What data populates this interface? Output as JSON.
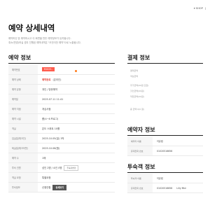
{
  "topnav": {
    "shop": "▾ SHOP",
    "sep": "|"
  },
  "page_title": "예약 상세내역",
  "description": [
    "예약하신 방 예약하시고 이 화면을 만든 예약정보가 유지됩니다.",
    "취소(변경)하실 경우 진행된 예약내역은 \"오전이전 예약\"으로 노출됩니다."
  ],
  "reservation": {
    "title": "예약 정보",
    "rows": [
      {
        "label": "예약번호",
        "value": "R2025..",
        "type": "badge"
      },
      {
        "label": "예약 상태",
        "value": "예약완료",
        "extra": "(온라인)",
        "type": "status"
      },
      {
        "label": "예약 유형",
        "value": "개인 / 방문예약"
      },
      {
        "label": "예약일",
        "value": "2025.07.11 11:41"
      },
      {
        "label": "예약 지점",
        "value": "개심사점"
      },
      {
        "label": "예약 시설",
        "value": "룸(4~6 프로그)"
      },
      {
        "label": "객실",
        "value": "온도 스위트 10를"
      },
      {
        "label": "입실일(체크인)",
        "value": "2025.10.05(일) 1박"
      },
      {
        "label": "퇴실일(체크아웃)",
        "value": "2025.10.06(월)"
      },
      {
        "label": "예약 수",
        "value": "1매"
      },
      {
        "label": "투숙 인원",
        "value": "성인 2명 / 소인 0명",
        "button": "투숙자변경"
      },
      {
        "label": "객실 요청",
        "value": "특별요청"
      },
      {
        "label": "투숙정보",
        "value": "신청안함",
        "button": "상세보기",
        "type": "dark"
      }
    ]
  },
  "payment": {
    "title": "결제 정보",
    "lines": [
      "결제금액",
      "객실금액",
      "추가금액(00원 포함)",
      "할인금액(00원)",
      "적립금액(00원)",
      "총 금액 0(0 원)"
    ]
  },
  "booker": {
    "title": "예약자 정보",
    "rows": [
      {
        "label": "예약자 이름",
        "value": "이유림"
      },
      {
        "label": "휴대전화 번호",
        "value": "01020516656"
      }
    ]
  },
  "guest": {
    "title": "투숙객 정보",
    "rows": [
      {
        "label": "투숙객 이름",
        "value": "이유림"
      },
      {
        "label": "휴대전화 번호",
        "value": "01020516656",
        "extra": "Lilly Mini"
      }
    ]
  },
  "colors": {
    "accent_red": "#e03a2e",
    "badge_red": "#ff5c4d",
    "dot_orange": "#ff7a1a"
  }
}
